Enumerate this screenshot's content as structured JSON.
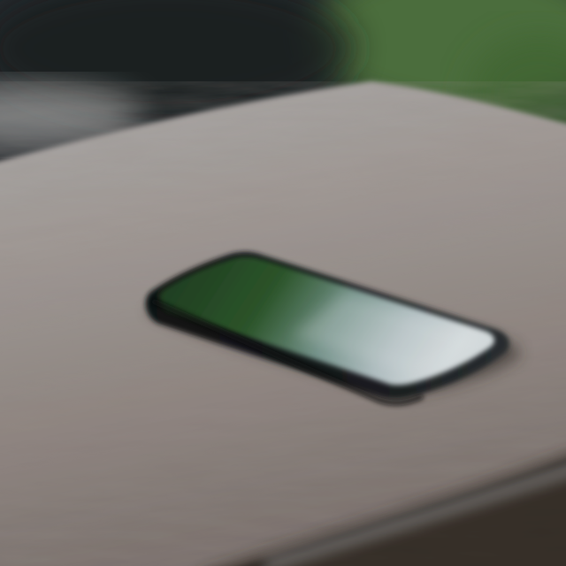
{
  "scene": {
    "subject": "smartphone-on-wooden-table",
    "colors": {
      "background_dark": "#262b2f",
      "foliage_green": "#5f8d46",
      "table_light": "#b7b3b0",
      "table_mid": "#9a928d",
      "table_dark": "#6f6661",
      "edge_shadow": "#3a302c",
      "phone_body": "#1c2022",
      "screen_green": "#2f5a2d",
      "screen_light": "#c9d3d6"
    }
  }
}
